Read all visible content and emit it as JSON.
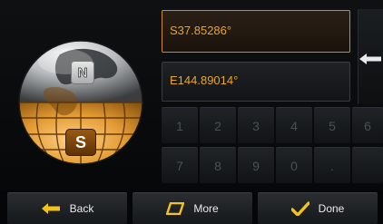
{
  "globe": {
    "north_label": "N",
    "south_label": "S",
    "selected_hemisphere": "S"
  },
  "coordinates": {
    "latitude": "S37.85286°",
    "longitude": "E144.89014°"
  },
  "keypad": {
    "keys": [
      "1",
      "2",
      "3",
      "4",
      "5",
      "6",
      "7",
      "8",
      "9",
      "0",
      "."
    ]
  },
  "bottom_bar": {
    "back_label": "Back",
    "more_label": "More",
    "done_label": "Done"
  },
  "colors": {
    "accent": "#e8a52a",
    "active_border": "#d18a1b"
  }
}
